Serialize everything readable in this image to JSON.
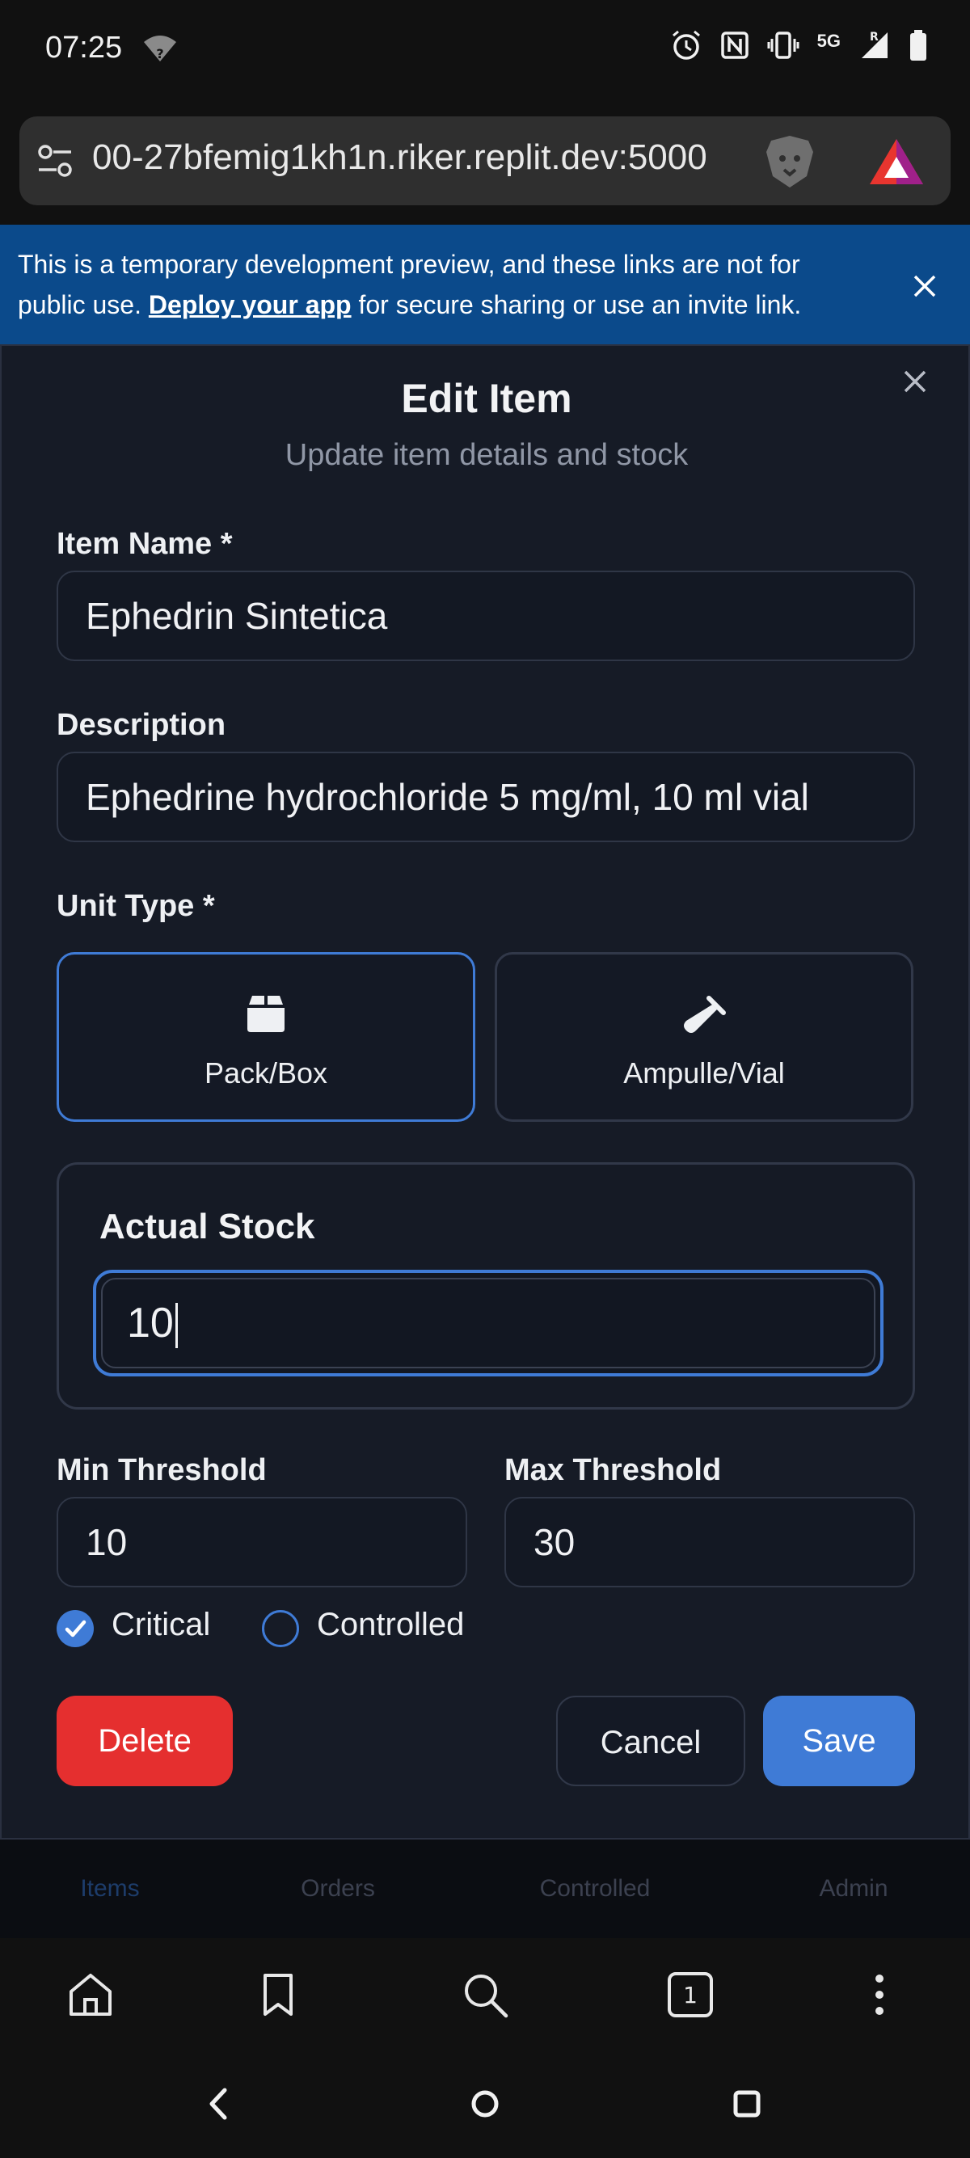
{
  "status_bar": {
    "time": "07:25",
    "network": "5G",
    "roaming": "R"
  },
  "browser": {
    "url": "00-27bfemig1kh1n.riker.replit.dev:5000",
    "tab_count": "1"
  },
  "banner": {
    "text_before": "This is a temporary development preview, and these links are not for public use. ",
    "link": "Deploy your app",
    "text_after": " for secure sharing or use an invite link."
  },
  "modal": {
    "title": "Edit Item",
    "subtitle": "Update item details and stock",
    "item_name_label": "Item Name *",
    "item_name_value": "Ephedrin Sintetica",
    "description_label": "Description",
    "description_value": "Ephedrine hydrochloride 5 mg/ml, 10 ml vial",
    "unit_type_label": "Unit Type *",
    "unit_types": [
      {
        "label": "Pack/Box",
        "icon": "box-icon",
        "selected": true
      },
      {
        "label": "Ampulle/Vial",
        "icon": "vial-icon",
        "selected": false
      }
    ],
    "stock_label": "Actual Stock",
    "stock_value": "10",
    "min_label": "Min Threshold",
    "min_value": "10",
    "max_label": "Max Threshold",
    "max_value": "30",
    "critical_label": "Critical",
    "critical_checked": true,
    "controlled_label": "Controlled",
    "controlled_checked": false,
    "delete_label": "Delete",
    "cancel_label": "Cancel",
    "save_label": "Save"
  },
  "app_nav": [
    "Items",
    "Orders",
    "Controlled",
    "Admin"
  ],
  "colors": {
    "accent": "#3f7bd6",
    "danger": "#e52f2f",
    "banner": "#0b4a8b",
    "modal_bg": "#161b26"
  }
}
